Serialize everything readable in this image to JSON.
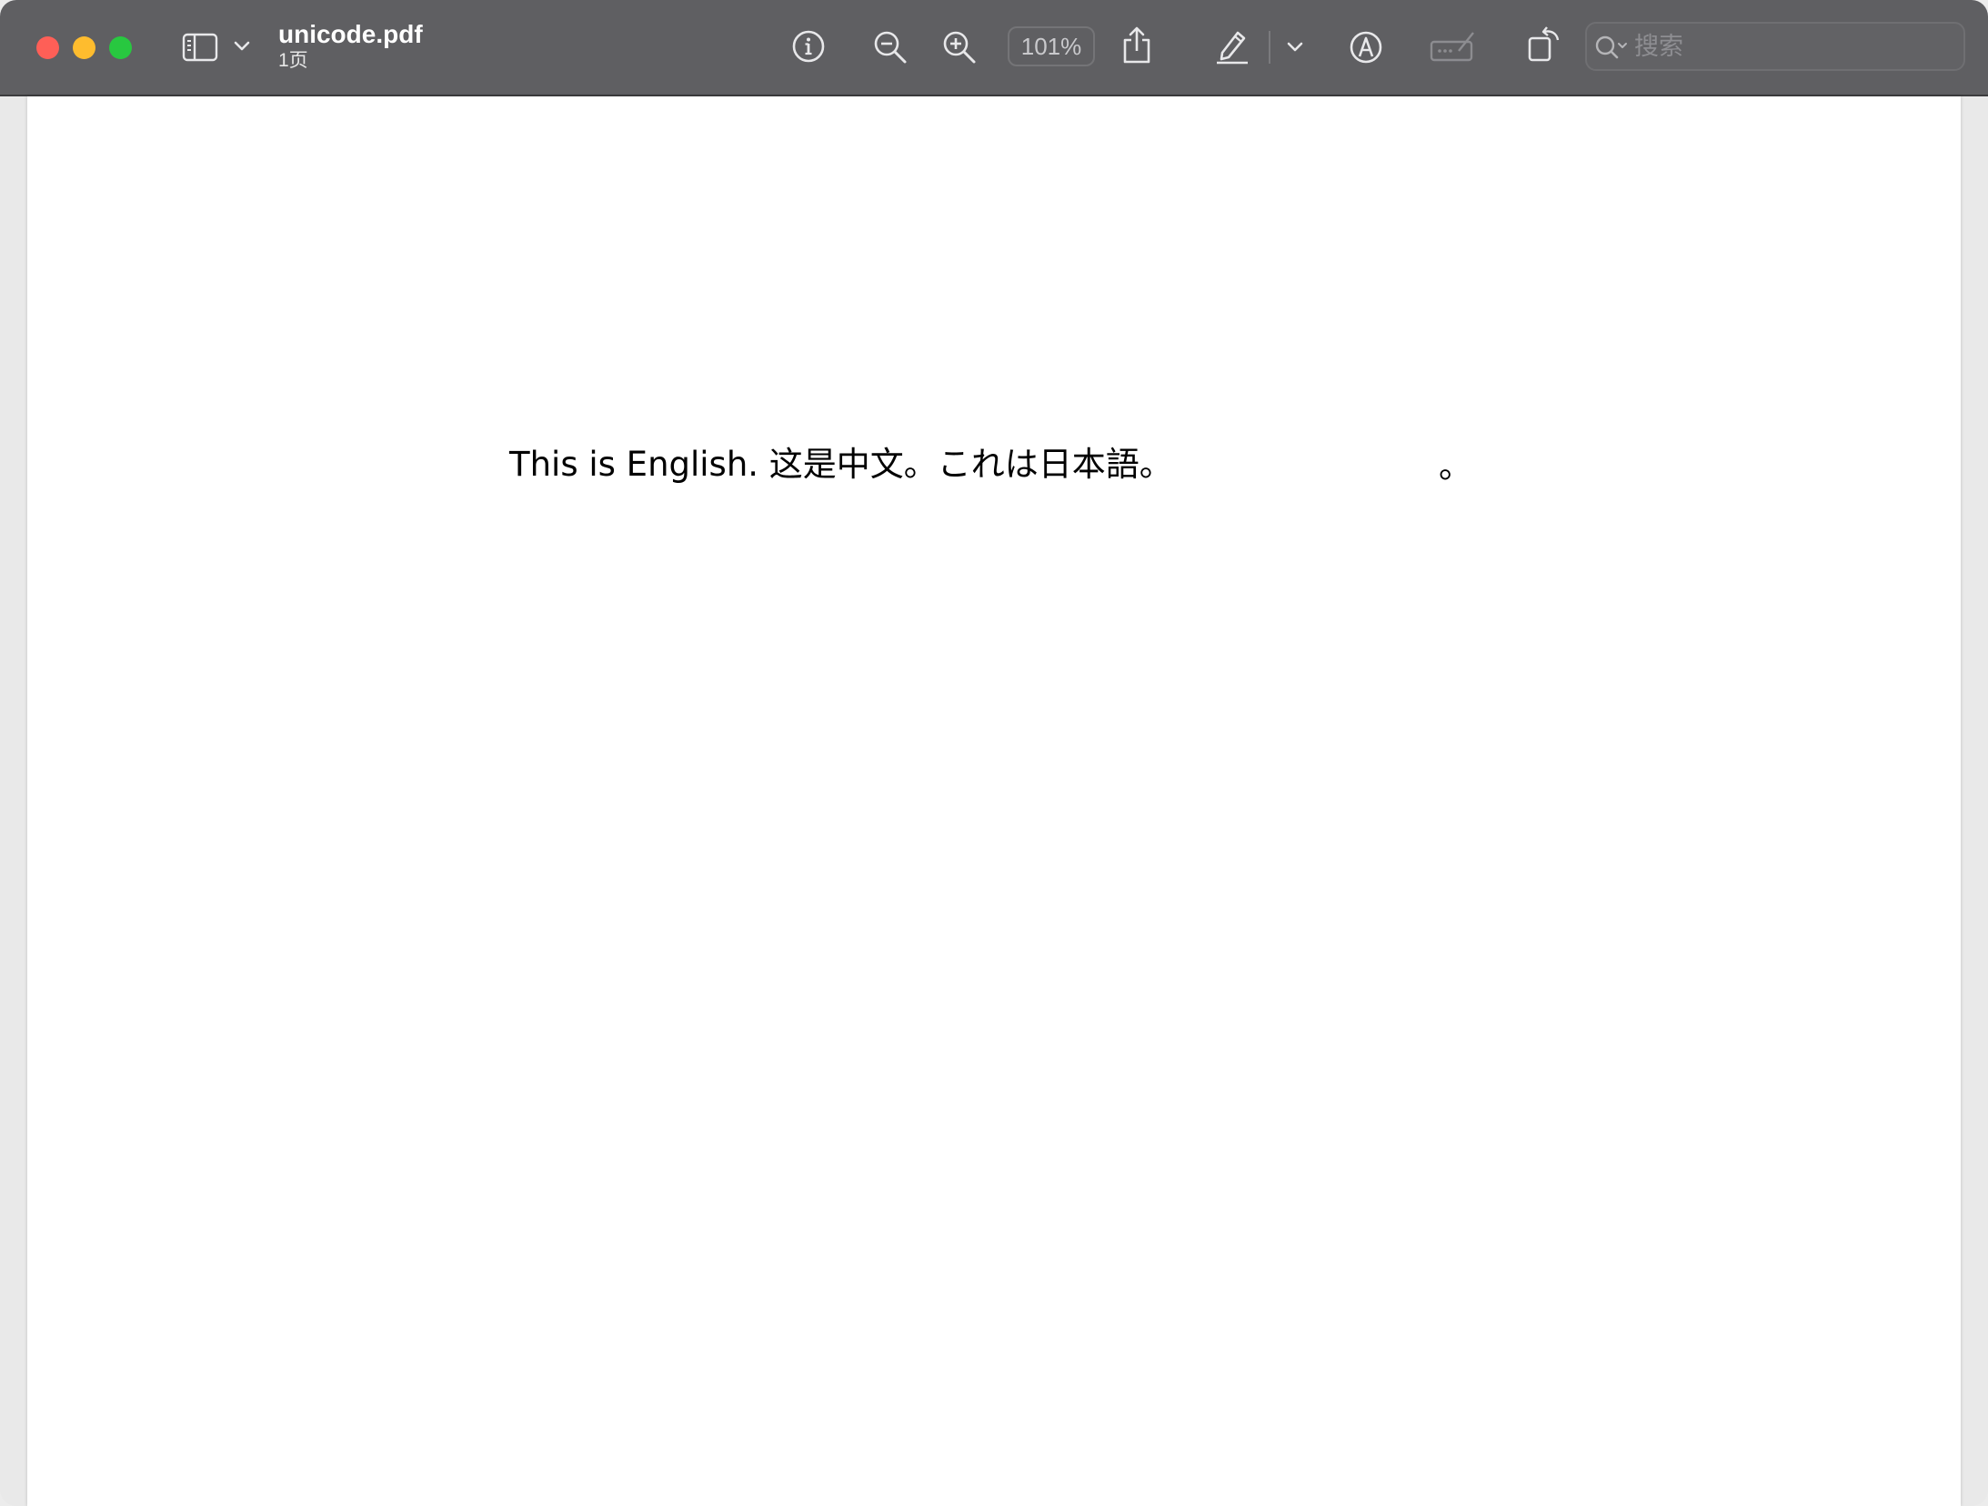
{
  "window": {
    "traffic_lights": {
      "close_color": "#fe5f57",
      "minimize_color": "#febc2e",
      "zoom_color": "#28c840"
    }
  },
  "toolbar": {
    "title": "unicode.pdf",
    "subtitle": "1页",
    "zoom_level": "101%",
    "search": {
      "placeholder": "搜索"
    },
    "icons": [
      "sidebar-icon",
      "chevron-down-icon",
      "info-icon",
      "zoom-out-icon",
      "zoom-in-icon",
      "share-icon",
      "highlight-pen-icon",
      "chevron-down-icon",
      "markup-icon",
      "signature-field-icon",
      "rotate-icon",
      "search-icon"
    ]
  },
  "document": {
    "text_line": "This is English. 这是中文。これは日本語。",
    "trailing_mark": "。"
  }
}
